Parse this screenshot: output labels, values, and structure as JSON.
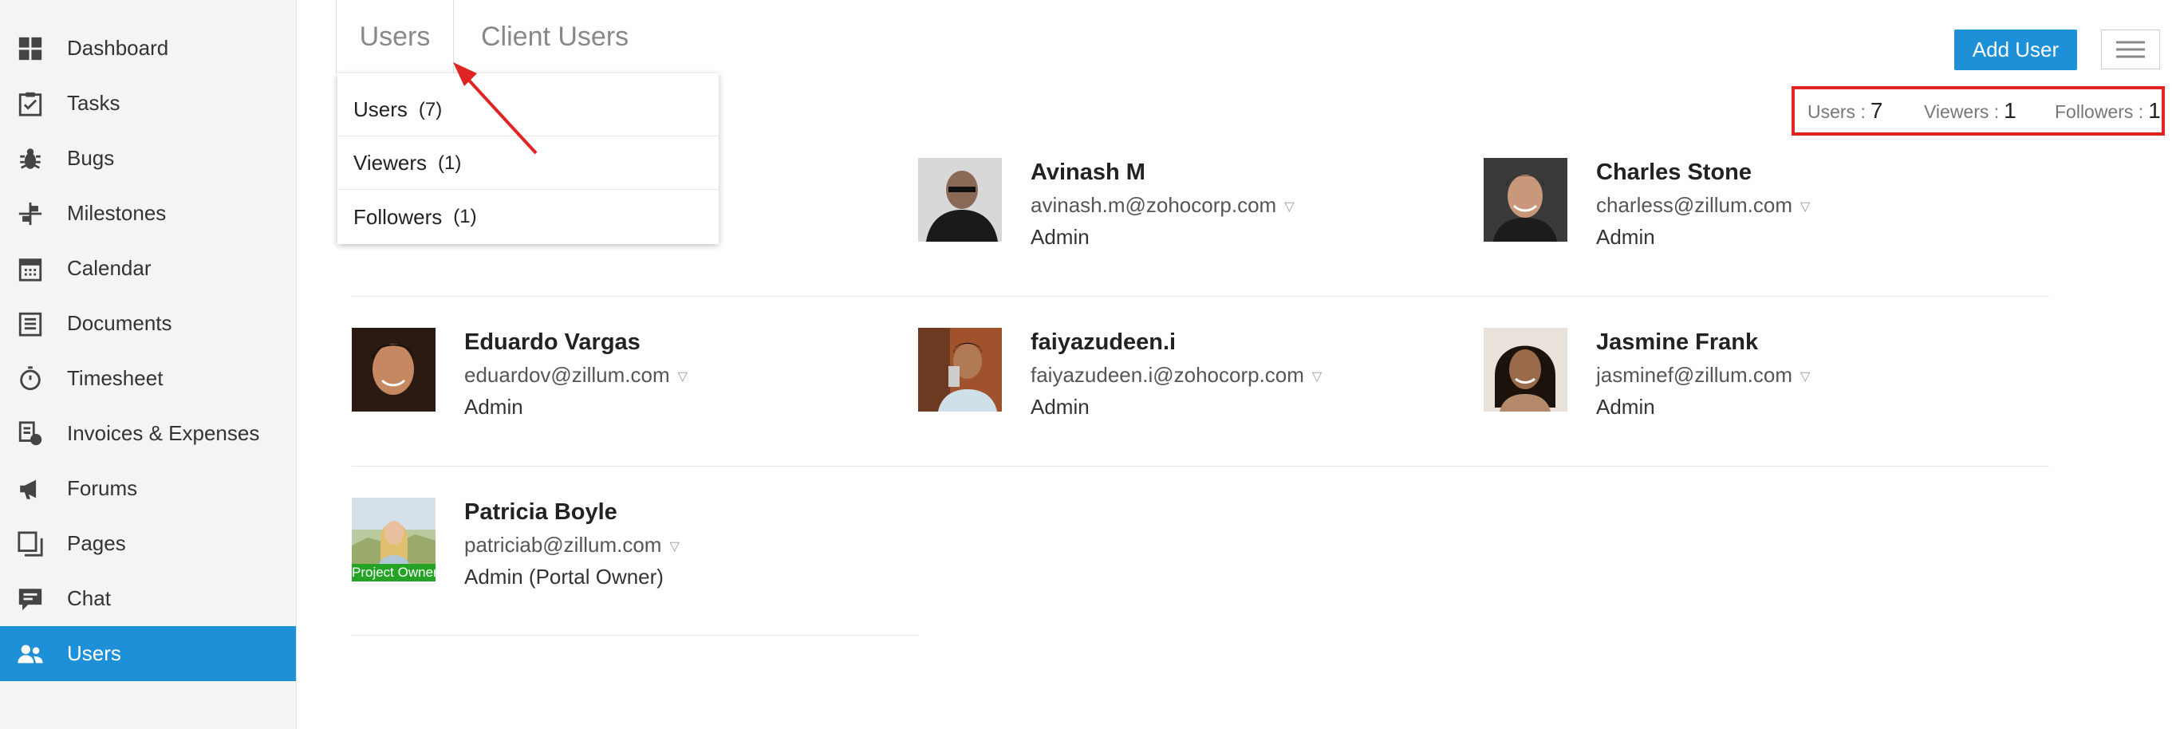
{
  "sidebar": {
    "items": [
      {
        "label": "Dashboard",
        "icon": "dashboard-icon"
      },
      {
        "label": "Tasks",
        "icon": "tasks-icon"
      },
      {
        "label": "Bugs",
        "icon": "bug-icon"
      },
      {
        "label": "Milestones",
        "icon": "milestone-icon"
      },
      {
        "label": "Calendar",
        "icon": "calendar-icon"
      },
      {
        "label": "Documents",
        "icon": "documents-icon"
      },
      {
        "label": "Timesheet",
        "icon": "timer-icon"
      },
      {
        "label": "Invoices & Expenses",
        "icon": "invoice-icon"
      },
      {
        "label": "Forums",
        "icon": "megaphone-icon"
      },
      {
        "label": "Pages",
        "icon": "pages-icon"
      },
      {
        "label": "Chat",
        "icon": "chat-icon"
      },
      {
        "label": "Users",
        "icon": "users-icon",
        "active": true
      }
    ]
  },
  "tabs": [
    {
      "label": "Users",
      "active": true
    },
    {
      "label": "Client Users"
    }
  ],
  "dropdown": {
    "items": [
      {
        "label": "Users",
        "count": "(7)"
      },
      {
        "label": "Viewers",
        "count": "(1)"
      },
      {
        "label": "Followers",
        "count": "(1)"
      }
    ]
  },
  "toolbar": {
    "add_user_label": "Add User"
  },
  "counts": {
    "users_label": "Users :",
    "users_value": "7",
    "viewers_label": "Viewers :",
    "viewers_value": "1",
    "followers_label": "Followers :",
    "followers_value": "1"
  },
  "users": [
    {
      "name": "Avinash M",
      "email": "avinash.m@zohocorp.com",
      "role": "Admin"
    },
    {
      "name": "Charles Stone",
      "email": "charless@zillum.com",
      "role": "Admin"
    },
    {
      "name": "Eduardo Vargas",
      "email": "eduardov@zillum.com",
      "role": "Admin"
    },
    {
      "name": "faiyazudeen.i",
      "email": "faiyazudeen.i@zohocorp.com",
      "role": "Admin"
    },
    {
      "name": "Jasmine Frank",
      "email": "jasminef@zillum.com",
      "role": "Admin"
    },
    {
      "name": "Patricia Boyle",
      "email": "patriciab@zillum.com",
      "role": "Admin (Portal Owner)",
      "badge": "Project Owner"
    }
  ],
  "colors": {
    "accent": "#1e90d8",
    "highlight": "#e02424",
    "owner_badge": "#25a325"
  }
}
